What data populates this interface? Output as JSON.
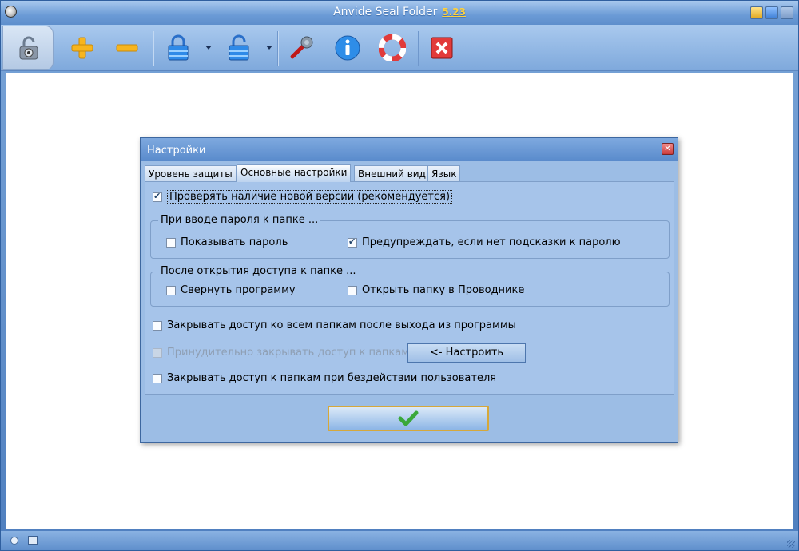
{
  "app": {
    "title": "Anvide Seal Folder",
    "version": "5.23"
  },
  "toolbar": {
    "icons": [
      "unlock-main-icon",
      "add-icon",
      "remove-icon",
      "lock-icon",
      "lock-alt-icon",
      "settings-icon",
      "info-icon",
      "help-icon",
      "exit-icon"
    ]
  },
  "dialog": {
    "title": "Настройки",
    "tabs": [
      {
        "label": "Уровень защиты",
        "active": false
      },
      {
        "label": "Основные настройки",
        "active": true
      },
      {
        "label": "Внешний вид",
        "active": false
      },
      {
        "label": "Язык",
        "active": false
      }
    ],
    "check_updates": {
      "label": "Проверять наличие новой версии  (рекомендуется)",
      "checked": true
    },
    "group_password": {
      "title": "При вводе пароля к папке ...",
      "show_password": {
        "label": "Показывать пароль",
        "checked": false
      },
      "warn_no_hint": {
        "label": "Предупреждать, если нет подсказки к паролю",
        "checked": true
      }
    },
    "group_open": {
      "title": "После открытия доступа к папке ...",
      "minimize": {
        "label": "Свернуть программу",
        "checked": false
      },
      "open_explorer": {
        "label": "Открыть папку в Проводнике",
        "checked": false
      }
    },
    "close_on_exit": {
      "label": "Закрывать доступ ко всем папкам после выхода из программы",
      "checked": false
    },
    "force_close": {
      "label": "Принудительно закрывать доступ к папкам",
      "checked": false,
      "disabled": true
    },
    "setup_button": "<- Настроить",
    "close_on_idle": {
      "label": "Закрывать доступ к папкам при бездействии пользователя",
      "checked": false
    }
  }
}
